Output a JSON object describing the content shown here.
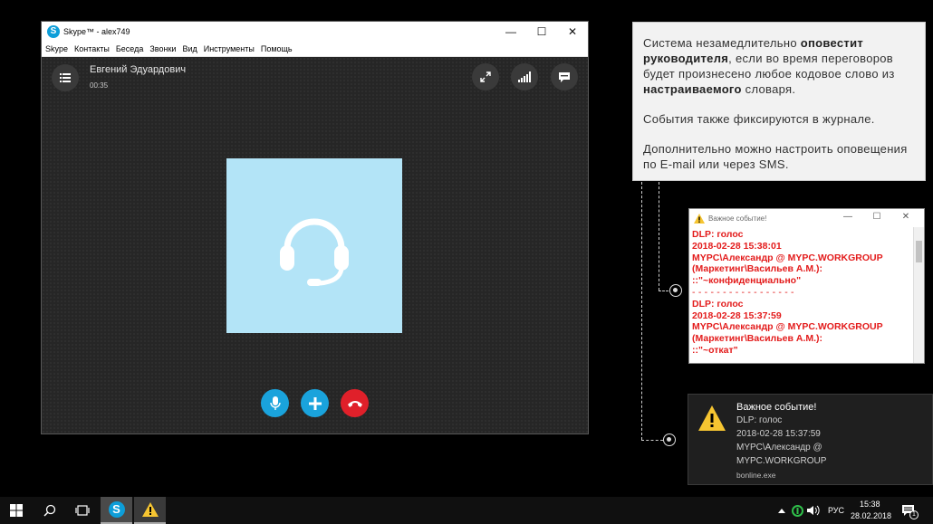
{
  "skype": {
    "title": "Skype™ - alex749",
    "logo_letter": "S",
    "menu": [
      "Skype",
      "Контакты",
      "Беседа",
      "Звонки",
      "Вид",
      "Инструменты",
      "Помощь"
    ],
    "caller_name": "Евгений Эдуардович",
    "call_time": "00:35"
  },
  "info": {
    "p1_a": "Система незамедлительно ",
    "p1_b": "оповестит руководителя",
    "p1_c": ", если во время переговоров будет произнесено любое кодовое слово из ",
    "p1_d": "настраиваемого",
    "p1_e": " словаря.",
    "p2": "События также фиксируются в журнале.",
    "p3": "Дополнительно можно настроить оповещения по E-mail или через SMS."
  },
  "popup": {
    "title": "Важное событие!",
    "events": [
      {
        "type": "DLP: голос",
        "time": "2018-02-28 15:38:01",
        "user": "MYPC\\Александр @ MYPC.WORKGROUP",
        "dept": "(Маркетинг\\Васильев А.М.):",
        "word": "::\"~конфиденциально\""
      },
      {
        "type": "DLP: голос",
        "time": "2018-02-28 15:37:59",
        "user": "MYPC\\Александр @ MYPC.WORKGROUP",
        "dept": "(Маркетинг\\Васильев А.М.):",
        "word": "::\"~откат\""
      }
    ],
    "separator": "- - - - - - - - - - - - - - - - -"
  },
  "toast": {
    "title": "Важное событие!",
    "line1": "DLP: голос",
    "line2": "2018-02-28 15:37:59",
    "line3": "MYPC\\Александр @",
    "line4": "MYPC.WORKGROUP",
    "source": "bonline.exe"
  },
  "taskbar": {
    "skype_letter": "S",
    "lang": "РУС",
    "time": "15:38",
    "date": "28.02.2018",
    "notif_count": "1"
  },
  "colors": {
    "skype_blue": "#0d9ed9",
    "hangup_red": "#e0202a",
    "alert_red": "#e31b1b",
    "avatar_bg": "#b3e4f7",
    "warn_yellow": "#f6c531"
  }
}
